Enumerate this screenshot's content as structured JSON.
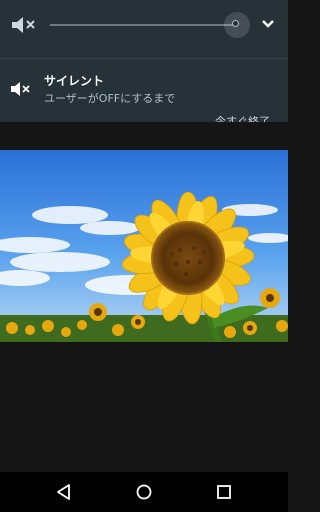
{
  "volume": {
    "mute_icon": "volume-mute-icon",
    "level": 0.95,
    "expand_icon": "chevron-down-icon"
  },
  "silent_mode": {
    "icon": "volume-mute-icon",
    "title": "サイレント",
    "subtitle": "ユーザーがOFFにするまで",
    "peek_text": "今すぐ終了"
  },
  "photo": {
    "subject": "sunflower-photo"
  },
  "nav_bar": {
    "back_icon": "back-triangle-icon",
    "home_icon": "home-circle-icon",
    "recents_icon": "recents-square-icon"
  },
  "colors": {
    "panel_bg": "#263238",
    "panel_text": "#ffffff",
    "panel_subtext": "#b0bec5",
    "screen_bg": "#151515",
    "nav_bg": "#000000"
  }
}
